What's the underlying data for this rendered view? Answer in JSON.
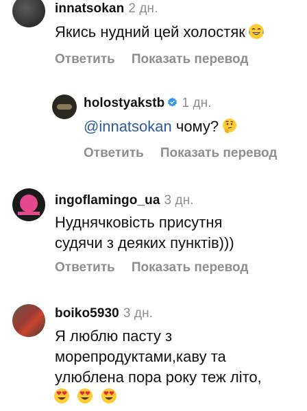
{
  "comments": [
    {
      "username": "innatsokan",
      "time": "2 дн.",
      "text": "Якись нудний цей холостяк",
      "emoji": "laughing-tears-emoji",
      "actions": {
        "reply": "Ответить",
        "translate": "Показать перевод"
      }
    },
    {
      "username": "holostyakstb",
      "verified": true,
      "time": "1 дн.",
      "mention": "@innatsokan",
      "text": " чому?",
      "emoji": "thinking-face-emoji",
      "actions": {
        "reply": "Ответить",
        "translate": "Показать перевод"
      }
    },
    {
      "username": "ingoflamingo_ua",
      "time": "3 дн.",
      "text_lines": [
        "Нуднячковість присутня",
        "судячи з деяких пунктів)))"
      ],
      "actions": {
        "reply": "Ответить",
        "translate": "Показать перевод"
      }
    },
    {
      "username": "boiko5930",
      "time": "3 дн.",
      "text_lines": [
        "Я люблю пасту з",
        "морепродуктами,каву та",
        "улюблена пора року теж літо,"
      ],
      "emojis": [
        "heart-eyes-emoji",
        "heart-eyes-emoji",
        "heart-eyes-emoji"
      ]
    }
  ],
  "colors": {
    "secondary": "#8e8e8e",
    "mention": "#2b5aa0",
    "verified": "#3897f0"
  }
}
